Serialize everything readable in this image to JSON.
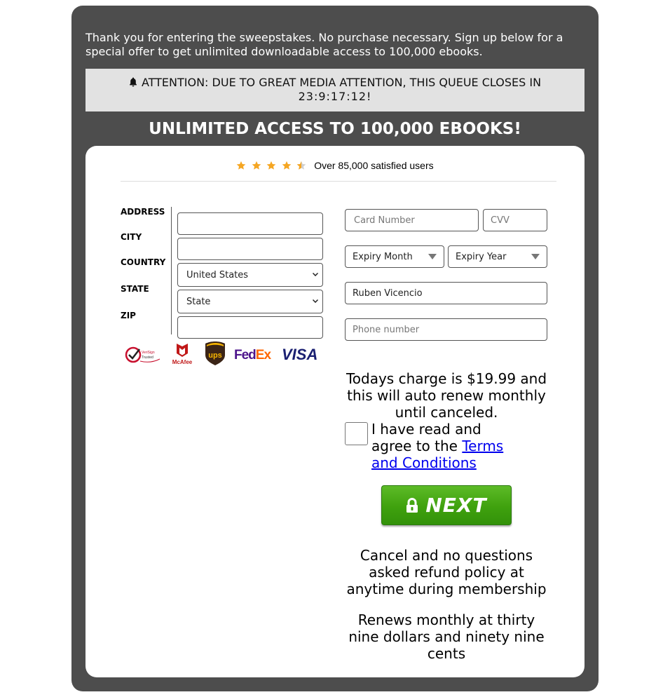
{
  "intro_text": "Thank you for entering the sweepstakes. No purchase necessary. Sign up below for a special offer to get unlimited downloadable access to 100,000 ebooks.",
  "attention": {
    "icon": "bell-icon",
    "text": "ATTENTION: DUE TO GREAT MEDIA ATTENTION, THIS QUEUE CLOSES IN",
    "countdown": "23:9:17:12!"
  },
  "headline": "UNLIMITED ACCESS TO 100,000 EBOOKS!",
  "rating": {
    "stars": 4.5,
    "star_color": "#f5a623",
    "text": "Over 85,000 satisfied users"
  },
  "address_form": {
    "labels": {
      "address": "ADDRESS",
      "city": "CITY",
      "country": "COUNTRY",
      "state": "STATE",
      "zip": "ZIP"
    },
    "values": {
      "address": "",
      "city": "",
      "country": "United States",
      "state": "State",
      "zip": ""
    }
  },
  "payment_form": {
    "card_number_placeholder": "Card Number",
    "cvv_placeholder": "CVV",
    "expiry_month": "Expiry Month",
    "expiry_year": "Expiry Year",
    "name_value": "Ruben Vicencio",
    "phone_placeholder": "Phone number"
  },
  "trust_logos": [
    "VeriSign Trusted",
    "McAfee",
    "ups",
    "FedEx",
    "VISA"
  ],
  "charge_text": "Todays charge is $19.99 and this will auto renew monthly until canceled.",
  "agree": {
    "checked": false,
    "text": "I have read and agree to the ",
    "link_text": "Terms and Conditions"
  },
  "next_button": "NEXT",
  "refund_text": "Cancel and no questions asked refund policy at anytime during membership",
  "renews_text": "Renews monthly at thirty nine dollars and ninety nine cents",
  "colors": {
    "panel_bg": "#4d4d4d",
    "attention_bg": "#e2e2e2",
    "button_green": "#3fa10e",
    "link": "#0000ee"
  }
}
